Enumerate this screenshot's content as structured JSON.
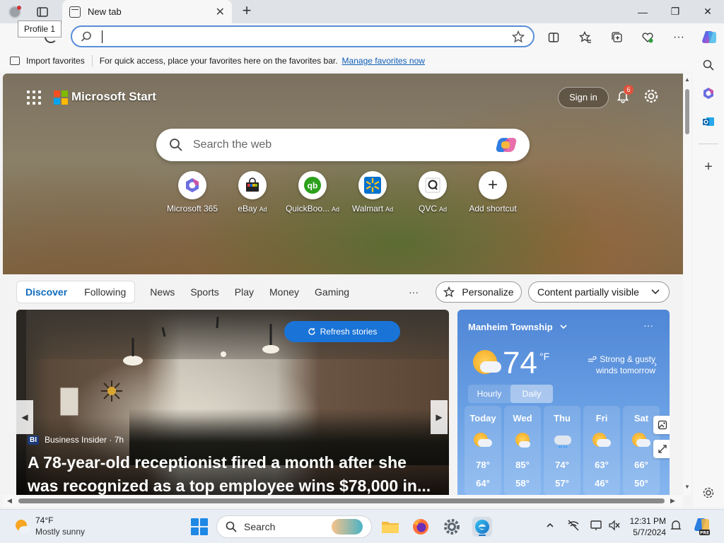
{
  "window": {
    "profile_tooltip": "Profile 1",
    "tab_title": "New tab",
    "tab_close": "✕",
    "new_tab": "+",
    "minimize": "—",
    "restore": "❐",
    "close": "✕"
  },
  "address_bar": {
    "value": "",
    "placeholder": ""
  },
  "favorites_bar": {
    "import_label": "Import favorites",
    "hint": "For quick access, place your favorites here on the favorites bar.",
    "manage_link": "Manage favorites now"
  },
  "start_page": {
    "brand": "Microsoft Start",
    "sign_in": "Sign in",
    "notification_count": "6",
    "search_placeholder": "Search the web",
    "shortcuts": [
      {
        "label": "Microsoft 365",
        "ad": "",
        "icon": "microsoft-365-icon"
      },
      {
        "label": "eBay",
        "ad": "Ad",
        "icon": "ebay-icon"
      },
      {
        "label": "QuickBoo...",
        "ad": "Ad",
        "icon": "quickbooks-icon"
      },
      {
        "label": "Walmart",
        "ad": "Ad",
        "icon": "walmart-icon"
      },
      {
        "label": "QVC",
        "ad": "Ad",
        "icon": "qvc-icon"
      },
      {
        "label": "Add shortcut",
        "ad": "",
        "icon": "plus-icon"
      }
    ]
  },
  "feed": {
    "tabs": [
      "Discover",
      "Following"
    ],
    "categories": [
      "News",
      "Sports",
      "Play",
      "Money",
      "Gaming"
    ],
    "more": "···",
    "personalize": "Personalize",
    "visibility": "Content partially visible",
    "refresh_stories": "Refresh stories",
    "story": {
      "source_badge": "BI",
      "source": "Business Insider · 7h",
      "headline": "A 78-year-old receptionist fired a month after she was recognized as a top employee wins $78,000 in..."
    }
  },
  "weather": {
    "location": "Manheim Township",
    "temp": "74",
    "unit": "°F",
    "note": "Strong & gusty winds tomorrow",
    "tabs": [
      "Hourly",
      "Daily"
    ],
    "days": [
      {
        "name": "Today",
        "hi": "78°",
        "lo": "64°"
      },
      {
        "name": "Wed",
        "hi": "85°",
        "lo": "58°"
      },
      {
        "name": "Thu",
        "hi": "74°",
        "lo": "57°"
      },
      {
        "name": "Fri",
        "hi": "63°",
        "lo": "46°"
      },
      {
        "name": "Sat",
        "hi": "66°",
        "lo": "50°"
      }
    ]
  },
  "taskbar": {
    "weather_temp": "74°F",
    "weather_condition": "Mostly sunny",
    "search_placeholder": "Search",
    "time": "12:31 PM",
    "date": "5/7/2024"
  },
  "colors": {
    "accent": "#0f6cbd",
    "link": "#0f5fb8",
    "refresh_button": "#1a73d6"
  }
}
